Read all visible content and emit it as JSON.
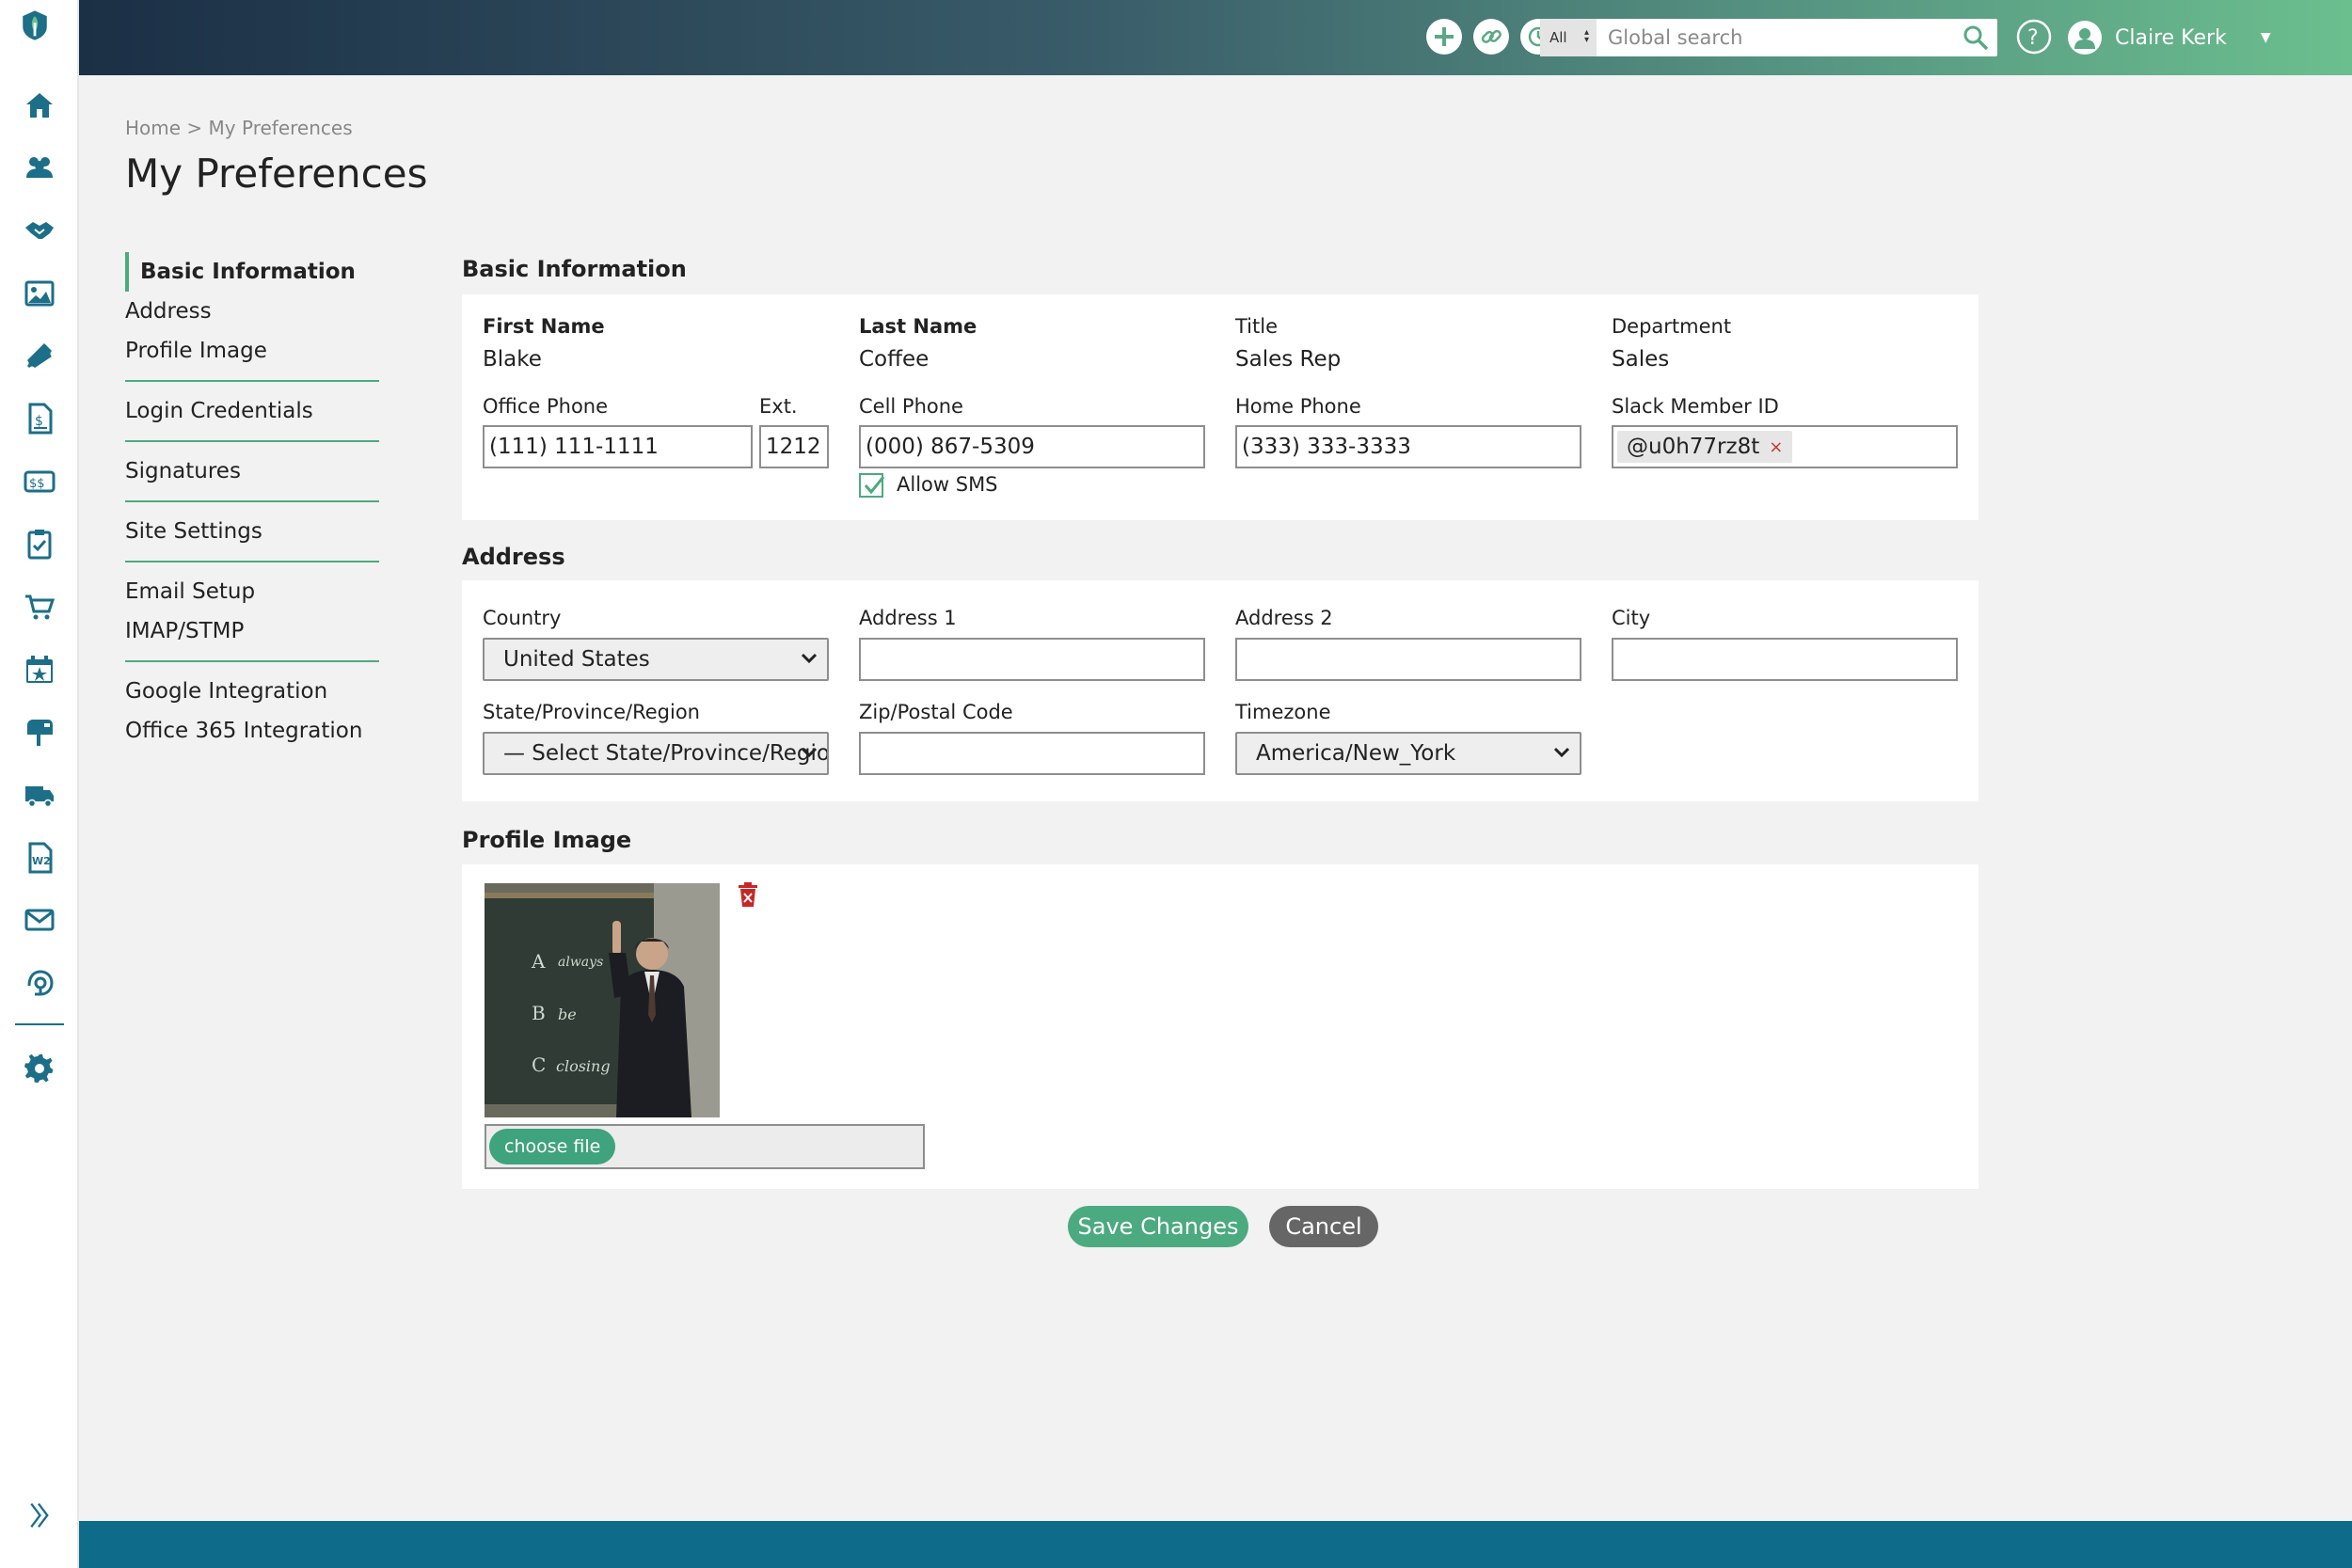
{
  "topbar": {
    "search_scope": "All",
    "search_placeholder": "Global search",
    "user_name": "Claire Kerk"
  },
  "breadcrumb": {
    "home": "Home",
    "separator": " > ",
    "current": "My Preferences"
  },
  "page_title": "My Preferences",
  "subnav": {
    "group1": [
      "Basic Information",
      "Address",
      "Profile Image"
    ],
    "group2": [
      "Login Credentials"
    ],
    "group3": [
      "Signatures"
    ],
    "group4": [
      "Site Settings"
    ],
    "group5": [
      "Email Setup",
      "IMAP/STMP"
    ],
    "group6": [
      "Google Integration",
      "Office 365 Integration"
    ]
  },
  "basic": {
    "section_title": "Basic Information",
    "first_name_label": "First Name",
    "first_name": "Blake",
    "last_name_label": "Last Name",
    "last_name": "Coffee",
    "title_label": "Title",
    "title": "Sales Rep",
    "department_label": "Department",
    "department": "Sales",
    "office_phone_label": "Office Phone",
    "office_phone": "(111) 111-1111",
    "ext_label": "Ext.",
    "ext": "1212",
    "cell_phone_label": "Cell Phone",
    "cell_phone": "(000) 867-5309",
    "allow_sms_label": "Allow SMS",
    "allow_sms_checked": true,
    "home_phone_label": "Home Phone",
    "home_phone": "(333) 333-3333",
    "slack_label": "Slack Member ID",
    "slack_tag": "@u0h77rz8t"
  },
  "address": {
    "section_title": "Address",
    "country_label": "Country",
    "country": "United States",
    "address1_label": "Address 1",
    "address1": "",
    "address2_label": "Address 2",
    "address2": "",
    "city_label": "City",
    "city": "",
    "state_label": "State/Province/Region",
    "state": "— Select State/Province/Region",
    "zip_label": "Zip/Postal Code",
    "zip": "",
    "timezone_label": "Timezone",
    "timezone": "America/New_York"
  },
  "profile_image": {
    "section_title": "Profile Image",
    "choose_file_label": "choose file"
  },
  "actions": {
    "save_label": "Save Changes",
    "cancel_label": "Cancel"
  },
  "colors": {
    "accent": "#4caa80",
    "rail_icon": "#1d6e88",
    "footer": "#0f6b8a",
    "delete": "#c62828"
  },
  "rail_icons": [
    "home-icon",
    "contacts-icon",
    "handshake-icon",
    "gallery-icon",
    "ticket-icon",
    "invoice-icon",
    "estimate-icon",
    "clipboard-icon",
    "cart-icon",
    "calendar-icon",
    "mailbox-icon",
    "truck-icon",
    "w2-icon",
    "mail-icon",
    "support-icon",
    "settings-icon"
  ]
}
